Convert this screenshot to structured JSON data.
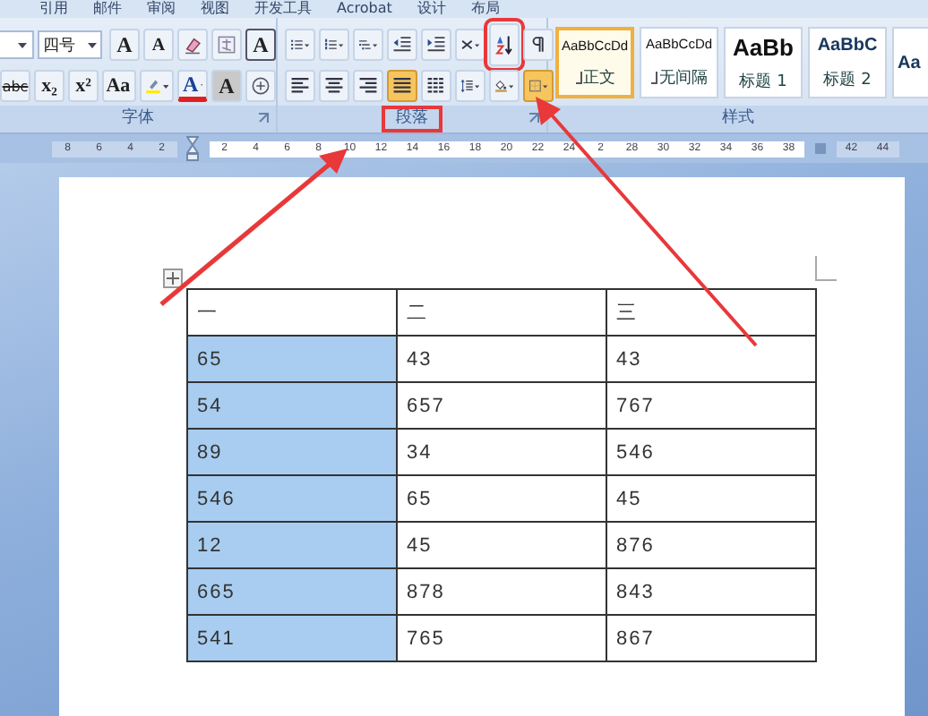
{
  "menu_tabs": [
    "引用",
    "邮件",
    "审阅",
    "视图",
    "开发工具",
    "Acrobat",
    "设计",
    "布局"
  ],
  "ribbon": {
    "font_group": {
      "label": "字体",
      "controls": [
        {
          "kind": "field"
        },
        {
          "kind": "dropdown",
          "text": "四号"
        },
        {
          "kind": "button",
          "text": "A"
        },
        {
          "kind": "button",
          "text": "A"
        },
        {
          "kind": "icon"
        },
        {
          "kind": "icon"
        },
        {
          "kind": "button",
          "text": "A"
        },
        {
          "kind": "button",
          "text": "abc"
        },
        {
          "kind": "button",
          "text": "x₂"
        },
        {
          "kind": "button",
          "text": "x²"
        },
        {
          "kind": "button",
          "text": "Aa"
        },
        {
          "kind": "icon"
        },
        {
          "kind": "button",
          "text": "A"
        },
        {
          "kind": "button",
          "text": "A"
        },
        {
          "kind": "icon"
        }
      ]
    },
    "paragraph_group": {
      "label": "段落",
      "annotated": true,
      "controls": [
        {
          "kind": "icon",
          "selected": false
        },
        {
          "kind": "icon",
          "selected": false
        },
        {
          "kind": "icon",
          "selected": false
        },
        {
          "kind": "icon",
          "selected": false
        },
        {
          "kind": "icon",
          "selected": false
        },
        {
          "kind": "icon",
          "selected": false
        },
        {
          "kind": "icon",
          "selected": false,
          "annotated": true
        },
        {
          "kind": "icon",
          "selected": false
        },
        {
          "kind": "icon",
          "selected": false
        },
        {
          "kind": "icon",
          "selected": false
        },
        {
          "kind": "icon",
          "selected": false
        },
        {
          "kind": "icon",
          "selected": true
        },
        {
          "kind": "icon",
          "selected": false
        },
        {
          "kind": "icon",
          "selected": false
        },
        {
          "kind": "icon",
          "selected": false
        },
        {
          "kind": "icon",
          "selected": true
        }
      ]
    },
    "styles_group": {
      "label": "样式",
      "styles": [
        {
          "preview": "AaBbCcDd",
          "name": "正文",
          "kind": "normal",
          "selected": true
        },
        {
          "preview": "AaBbCcDd",
          "name": "无间隔",
          "kind": "normal",
          "selected": false
        },
        {
          "preview": "AaBb",
          "name": "标题 1",
          "kind": "heading1",
          "selected": false
        },
        {
          "preview": "AaBbC",
          "name": "标题 2",
          "kind": "heading2",
          "selected": false
        },
        {
          "preview": "Aa",
          "kind": "heading2",
          "selected": false
        }
      ]
    }
  },
  "ruler": [
    {
      "kind": "number",
      "text": "8"
    },
    {
      "kind": "number",
      "text": "6"
    },
    {
      "kind": "number",
      "text": "4"
    },
    {
      "kind": "number",
      "text": "2"
    },
    {
      "kind": "indent-marker"
    },
    {
      "kind": "number",
      "text": "2"
    },
    {
      "kind": "number",
      "text": "4"
    },
    {
      "kind": "number",
      "text": "6"
    },
    {
      "kind": "number",
      "text": "8"
    },
    {
      "kind": "number",
      "text": "10"
    },
    {
      "kind": "number",
      "text": "12"
    },
    {
      "kind": "number",
      "text": "14"
    },
    {
      "kind": "number",
      "text": "16"
    },
    {
      "kind": "number",
      "text": "18"
    },
    {
      "kind": "number",
      "text": "20"
    },
    {
      "kind": "number",
      "text": "22"
    },
    {
      "kind": "number",
      "text": "24"
    },
    {
      "kind": "number",
      "text": "2"
    },
    {
      "kind": "number",
      "text": "28"
    },
    {
      "kind": "number",
      "text": "30"
    },
    {
      "kind": "number",
      "text": "32"
    },
    {
      "kind": "number",
      "text": "34"
    },
    {
      "kind": "number",
      "text": "36"
    },
    {
      "kind": "number",
      "text": "38"
    },
    {
      "kind": "margin-marker"
    },
    {
      "kind": "number",
      "text": "42"
    },
    {
      "kind": "number",
      "text": "44"
    }
  ],
  "table": {
    "header": [
      "一",
      "二",
      "三"
    ],
    "rows": [
      {
        "cells": [
          {
            "text": "65",
            "selected": true
          },
          {
            "text": "43",
            "selected": false
          },
          {
            "text": "43",
            "selected": false
          }
        ]
      },
      {
        "cells": [
          {
            "text": "54",
            "selected": true
          },
          {
            "text": "657",
            "selected": false
          },
          {
            "text": "767",
            "selected": false
          }
        ]
      },
      {
        "cells": [
          {
            "text": "89",
            "selected": true
          },
          {
            "text": "34",
            "selected": false
          },
          {
            "text": "546",
            "selected": false
          }
        ]
      },
      {
        "cells": [
          {
            "text": "546",
            "selected": true
          },
          {
            "text": "65",
            "selected": false
          },
          {
            "text": "45",
            "selected": false
          }
        ]
      },
      {
        "cells": [
          {
            "text": "12",
            "selected": true
          },
          {
            "text": "45",
            "selected": false
          },
          {
            "text": "876",
            "selected": false
          }
        ]
      },
      {
        "cells": [
          {
            "text": "665",
            "selected": true
          },
          {
            "text": "878",
            "selected": false
          },
          {
            "text": "843",
            "selected": false
          }
        ]
      },
      {
        "cells": [
          {
            "text": "541",
            "selected": true
          },
          {
            "text": "765",
            "selected": false
          },
          {
            "text": "867",
            "selected": false
          }
        ]
      }
    ]
  }
}
